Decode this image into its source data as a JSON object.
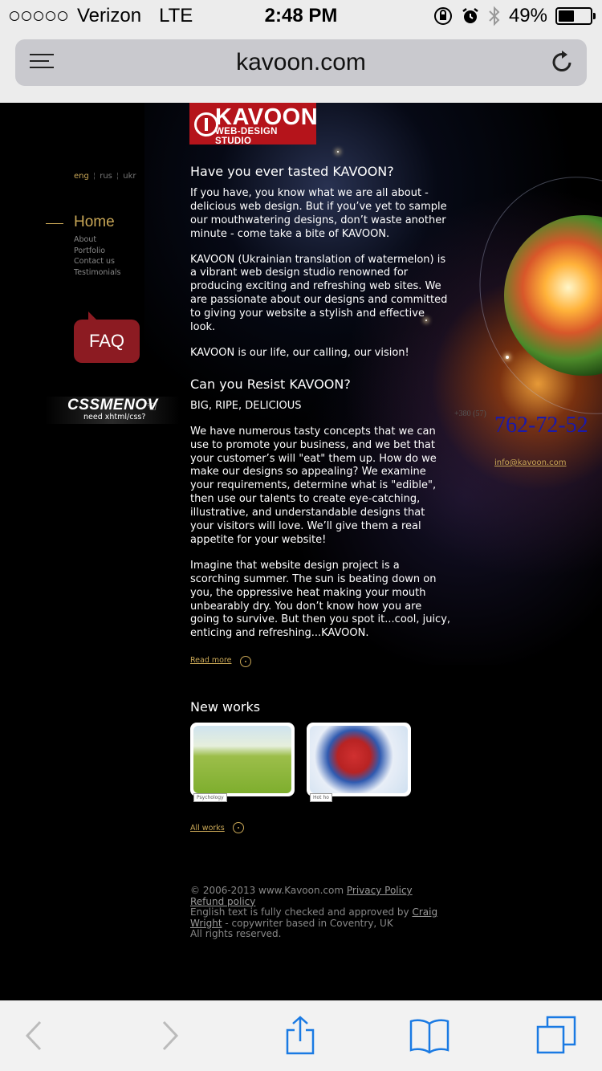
{
  "status_bar": {
    "carrier": "Verizon",
    "network": "LTE",
    "time": "2:48 PM",
    "battery_percent": "49%",
    "battery_level": 0.49
  },
  "browser": {
    "url": "kavoon.com"
  },
  "site": {
    "logo": {
      "name": "KAVOON",
      "subtitle": "WEB-DESIGN STUDIO"
    },
    "languages": [
      "eng",
      "rus",
      "ukr"
    ],
    "nav": {
      "home": "Home",
      "items": [
        "About",
        "Portfolio",
        "Contact us",
        "Testimonials"
      ]
    },
    "faq_label": "FAQ",
    "css_banner": {
      "title": "CSSMENOV",
      "subtitle": "need xhtml/css?"
    },
    "intro": {
      "heading": "Have you ever tasted KAVOON?",
      "p1": "If you have, you know what we are all about - delicious web design. But if you’ve yet to sample our mouthwatering designs, don’t waste another minute - come take a bite of KAVOON.",
      "p2": "KAVOON (Ukrainian translation of watermelon) is a vibrant web design studio renowned for producing exciting and refreshing web sites. We are passionate about our designs and committed to giving your website a stylish and effective look.",
      "p3": "KAVOON is our life, our calling, our vision!"
    },
    "resist": {
      "heading": "Can you Resist KAVOON?",
      "tagline": "BIG, RIPE, DELICIOUS",
      "p1": "We have numerous tasty concepts that we can use to promote your business, and we bet that your customer’s will \"eat\" them up. How do we make our designs so appealing? We examine your requirements, determine what is \"edible\", then use our talents to create eye-catching, illustrative, and understandable designs that your visitors will love. We’ll give them a real appetite for your website!",
      "p2": "Imagine that website design project is a scorching summer. The sun is beating down on you, the oppressive heat making your mouth unbearably dry. You don’t know how you are going to survive. But then you spot it...cool, juicy, enticing and refreshing...KAVOON."
    },
    "read_more": "Read more",
    "new_works": {
      "title": "New works",
      "items": [
        {
          "caption": "Psychology"
        },
        {
          "caption": "Hot ho"
        }
      ],
      "all_works": "All works"
    },
    "contact": {
      "phone_prefix": "+380 (57)",
      "phone": "762-72-52",
      "email": "info@kavoon.com"
    },
    "footer": {
      "copyright": "© 2006-2013 www.Kavoon.com",
      "privacy": "Privacy Policy",
      "refund": "Refund policy",
      "checked_by": "English text is fully checked and approved by",
      "author": "Craig Wright",
      "author_note": "- copywriter based in Coventry, UK",
      "rights": "All rights reserved."
    }
  },
  "colors": {
    "accent_gold": "#c8a656",
    "brand_red": "#b5141b",
    "ios_blue": "#1a7ae3"
  }
}
